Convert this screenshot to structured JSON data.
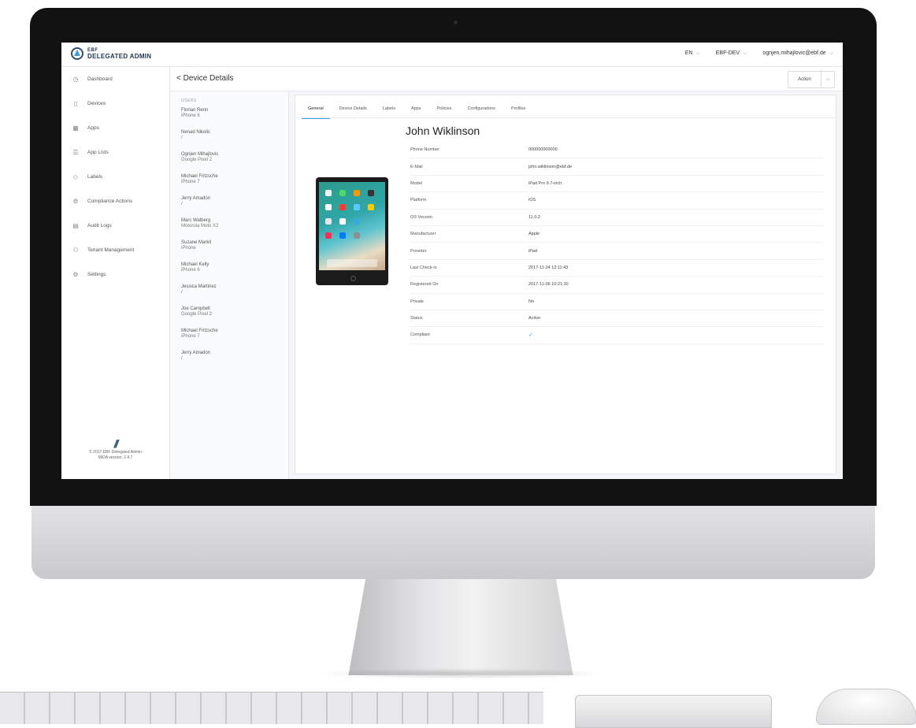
{
  "app": {
    "logo_small": "EBF",
    "logo_big": "DELEGATED ADMIN",
    "language": "EN",
    "tenant": "EBF-DEV",
    "user_email": "ognjen.mihajlovic@ebf.de"
  },
  "sidebar": {
    "items": [
      {
        "label": "Dashboard",
        "icon": "clock-icon"
      },
      {
        "label": "Devices",
        "icon": "device-icon"
      },
      {
        "label": "Apps",
        "icon": "grid-icon"
      },
      {
        "label": "App Lists",
        "icon": "list-icon"
      },
      {
        "label": "Labels",
        "icon": "tag-icon"
      },
      {
        "label": "Compliance Actions",
        "icon": "compliance-icon"
      },
      {
        "label": "Audit Logs",
        "icon": "log-icon"
      },
      {
        "label": "Tenant Management",
        "icon": "users-icon"
      },
      {
        "label": "Settings",
        "icon": "gear-icon"
      }
    ],
    "footer_line1": "© 2017 EBF Delegated Admin",
    "footer_line2": "MIDA version: 2.4.7"
  },
  "header": {
    "back_label": "Device Details",
    "action_label": "Action"
  },
  "users": {
    "title": "USERS",
    "list": [
      {
        "name": "Florian Renn",
        "device": "iPhone 6"
      },
      {
        "name": "Nenad Nikolic",
        "device": "/"
      },
      {
        "name": "Ognjen Mihajlovic",
        "device": "Google Pixel 2"
      },
      {
        "name": "Michael Fritzsche",
        "device": "iPhone 7"
      },
      {
        "name": "Jerry Amadon",
        "device": "/"
      },
      {
        "name": "Marc Walberg",
        "device": "Motorola Moto X2"
      },
      {
        "name": "Suzane Markit",
        "device": "iPhone"
      },
      {
        "name": "Michael Kelly",
        "device": "iPhone 6"
      },
      {
        "name": "Jessica Martinez",
        "device": "/"
      },
      {
        "name": "Joe Campbell",
        "device": "Google Pixel 2"
      },
      {
        "name": "Michael Fritzsche",
        "device": "iPhone 7"
      },
      {
        "name": "Jerry Amadon",
        "device": "/"
      }
    ]
  },
  "tabs": [
    {
      "label": "General",
      "active": true
    },
    {
      "label": "Device Details",
      "active": false
    },
    {
      "label": "Labels",
      "active": false
    },
    {
      "label": "Apps",
      "active": false
    },
    {
      "label": "Policies",
      "active": false
    },
    {
      "label": "Configurations",
      "active": false
    },
    {
      "label": "Profiles",
      "active": false
    }
  ],
  "device": {
    "owner_name": "John Wiklinson",
    "fields": [
      {
        "label": "Phone Number",
        "value": "000000000000"
      },
      {
        "label": "E-Mail",
        "value": "john.wiklinson@ebf.de"
      },
      {
        "label": "Model",
        "value": "iPad Pro 9.7-inch"
      },
      {
        "label": "Platform",
        "value": "iOS"
      },
      {
        "label": "OS Version",
        "value": "11.0.2"
      },
      {
        "label": "Manufacturer",
        "value": "Apple"
      },
      {
        "label": "Provider",
        "value": "iPad"
      },
      {
        "label": "Last Check-in",
        "value": "2017-11-24 12:11:43"
      },
      {
        "label": "Registered On",
        "value": "2017-11-06 10:21:30"
      },
      {
        "label": "Private",
        "value": "No"
      },
      {
        "label": "Status",
        "value": "Active"
      },
      {
        "label": "Compliant",
        "value": "✓"
      }
    ]
  },
  "colors": {
    "accent": "#3a9bd5",
    "brand": "#2f4e6f"
  }
}
